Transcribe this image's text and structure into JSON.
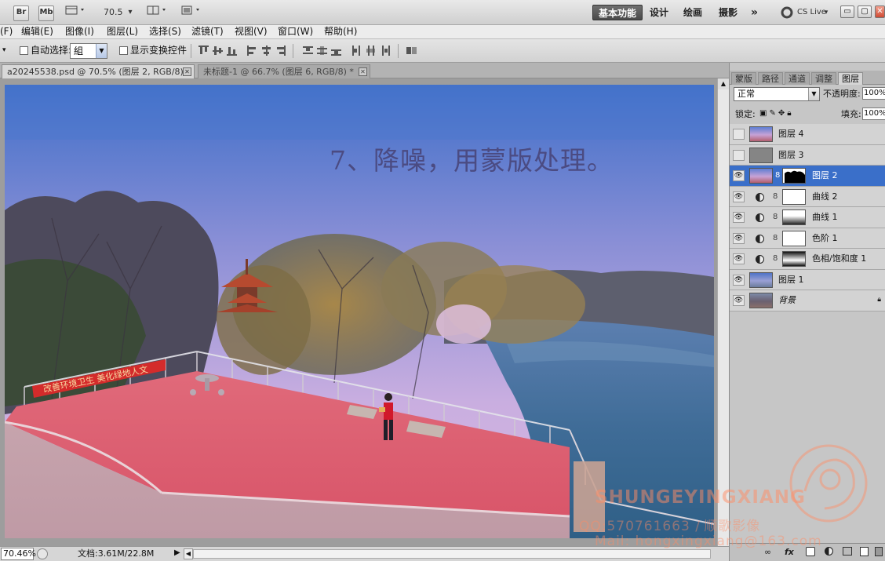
{
  "appbar": {
    "br_label": "Br",
    "mb_label": "Mb",
    "zoom_value": "70.5",
    "workspaces": [
      "基本功能",
      "设计",
      "绘画",
      "摄影"
    ],
    "more_label": "»",
    "cslive_label": "CS Live",
    "window_buttons": [
      "▭",
      "▢",
      "✕"
    ]
  },
  "menu": {
    "items": [
      "(F)",
      "编辑(E)",
      "图像(I)",
      "图层(L)",
      "选择(S)",
      "滤镜(T)",
      "视图(V)",
      "窗口(W)",
      "帮助(H)"
    ]
  },
  "options": {
    "auto_select_label": "自动选择:",
    "auto_select_value": "組",
    "show_transform_label": "显示变换控件"
  },
  "document_tabs": [
    {
      "label": "a20245538.psd @ 70.5% (图层 2, RGB/8) *",
      "active": true
    },
    {
      "label": "未标题-1 @ 66.7% (图层 6, RGB/8) *",
      "active": false
    }
  ],
  "canvas": {
    "caption": "7、降噪，用蒙版处理。",
    "banner_text": "改善环境卫生  美化绿地人文"
  },
  "statusbar": {
    "zoom": "70.46%",
    "doc_info": "文档:3.61M/22.8M"
  },
  "panel": {
    "tabs": [
      "蒙版",
      "路径",
      "通道",
      "调整",
      "图层"
    ],
    "active_tab": "图层",
    "blend_mode": "正常",
    "opacity_label": "不透明度:",
    "opacity_value": "100%",
    "lock_label": "锁定:",
    "fill_label": "填充:",
    "fill_value": "100%",
    "layers": [
      {
        "name": "图层 4",
        "visible": false,
        "kind": "photo"
      },
      {
        "name": "图层 3",
        "visible": false,
        "kind": "gray"
      },
      {
        "name": "图层 2",
        "visible": true,
        "kind": "masked",
        "selected": true
      },
      {
        "name": "曲线 2",
        "visible": true,
        "kind": "adjust-white"
      },
      {
        "name": "曲线 1",
        "visible": true,
        "kind": "adjust-gradient"
      },
      {
        "name": "色阶 1",
        "visible": true,
        "kind": "adjust-white"
      },
      {
        "name": "色相/饱和度 1",
        "visible": true,
        "kind": "adjust-gradient"
      },
      {
        "name": "图层 1",
        "visible": true,
        "kind": "photo"
      },
      {
        "name": "背景",
        "visible": true,
        "kind": "background",
        "locked": true
      }
    ],
    "bottom_icons": [
      "∞",
      "fx"
    ]
  },
  "watermark": {
    "line1": "SHUNGEYINGXIANG",
    "line2": "QQ:570761663 / 顺歌影像",
    "line3": "Mail: hongxingxiang@163.com"
  },
  "colors": {
    "selected_layer": "#3a6fc9",
    "caption": "#4b4b82",
    "banner": "#d42b2b"
  }
}
